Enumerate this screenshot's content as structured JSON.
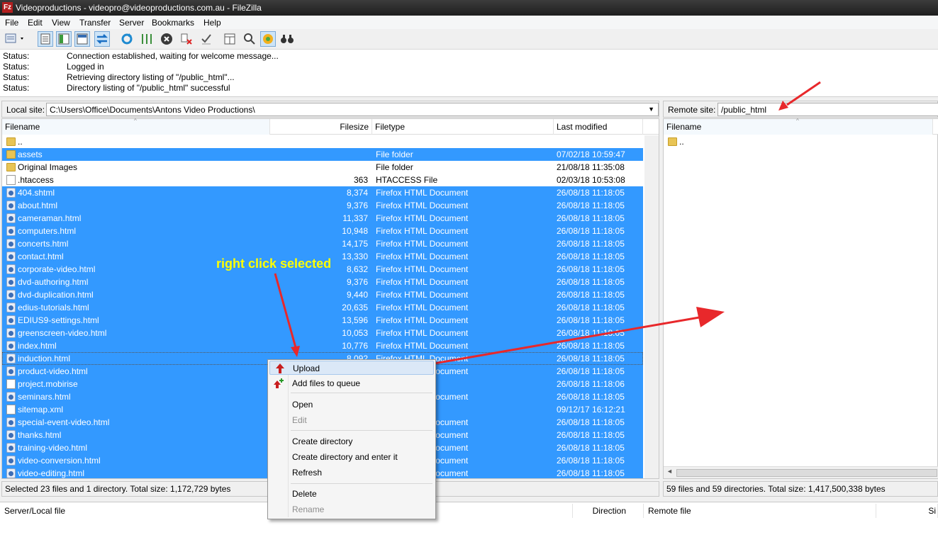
{
  "window": {
    "title": "Videoproductions - videopro@videoproductions.com.au - FileZilla",
    "app_icon": "Fz"
  },
  "menu": [
    "File",
    "Edit",
    "View",
    "Transfer",
    "Server",
    "Bookmarks",
    "Help"
  ],
  "log": [
    {
      "label": "Status:",
      "message": "Connection established, waiting for welcome message..."
    },
    {
      "label": "Status:",
      "message": "Logged in"
    },
    {
      "label": "Status:",
      "message": "Retrieving directory listing of \"/public_html\"..."
    },
    {
      "label": "Status:",
      "message": "Directory listing of \"/public_html\" successful"
    }
  ],
  "local": {
    "site_label": "Local site:",
    "path": "C:\\Users\\Office\\Documents\\Antons Video Productions\\",
    "columns": [
      "Filename",
      "Filesize",
      "Filetype",
      "Last modified"
    ],
    "files": [
      {
        "name": "..",
        "size": "",
        "type": "",
        "modified": "",
        "icon": "folder",
        "sel": false
      },
      {
        "name": "assets",
        "size": "",
        "type": "File folder",
        "modified": "07/02/18 10:59:47",
        "icon": "folder",
        "sel": true
      },
      {
        "name": "Original Images",
        "size": "",
        "type": "File folder",
        "modified": "21/08/18 11:35:08",
        "icon": "folder",
        "sel": false
      },
      {
        "name": ".htaccess",
        "size": "363",
        "type": "HTACCESS File",
        "modified": "02/03/18 10:53:08",
        "icon": "plain",
        "sel": false
      },
      {
        "name": "404.shtml",
        "size": "8,374",
        "type": "Firefox HTML Document",
        "modified": "26/08/18 11:18:05",
        "icon": "html",
        "sel": true
      },
      {
        "name": "about.html",
        "size": "9,376",
        "type": "Firefox HTML Document",
        "modified": "26/08/18 11:18:05",
        "icon": "html",
        "sel": true
      },
      {
        "name": "cameraman.html",
        "size": "11,337",
        "type": "Firefox HTML Document",
        "modified": "26/08/18 11:18:05",
        "icon": "html",
        "sel": true
      },
      {
        "name": "computers.html",
        "size": "10,948",
        "type": "Firefox HTML Document",
        "modified": "26/08/18 11:18:05",
        "icon": "html",
        "sel": true
      },
      {
        "name": "concerts.html",
        "size": "14,175",
        "type": "Firefox HTML Document",
        "modified": "26/08/18 11:18:05",
        "icon": "html",
        "sel": true
      },
      {
        "name": "contact.html",
        "size": "13,330",
        "type": "Firefox HTML Document",
        "modified": "26/08/18 11:18:05",
        "icon": "html",
        "sel": true
      },
      {
        "name": "corporate-video.html",
        "size": "8,632",
        "type": "Firefox HTML Document",
        "modified": "26/08/18 11:18:05",
        "icon": "html",
        "sel": true
      },
      {
        "name": "dvd-authoring.html",
        "size": "9,376",
        "type": "Firefox HTML Document",
        "modified": "26/08/18 11:18:05",
        "icon": "html",
        "sel": true
      },
      {
        "name": "dvd-duplication.html",
        "size": "9,440",
        "type": "Firefox HTML Document",
        "modified": "26/08/18 11:18:05",
        "icon": "html",
        "sel": true
      },
      {
        "name": "edius-tutorials.html",
        "size": "20,635",
        "type": "Firefox HTML Document",
        "modified": "26/08/18 11:18:05",
        "icon": "html",
        "sel": true
      },
      {
        "name": "EDIUS9-settings.html",
        "size": "13,596",
        "type": "Firefox HTML Document",
        "modified": "26/08/18 11:18:05",
        "icon": "html",
        "sel": true
      },
      {
        "name": "greenscreen-video.html",
        "size": "10,053",
        "type": "Firefox HTML Document",
        "modified": "26/08/18 11:18:05",
        "icon": "html",
        "sel": true
      },
      {
        "name": "index.html",
        "size": "10,776",
        "type": "Firefox HTML Document",
        "modified": "26/08/18 11:18:05",
        "icon": "html",
        "sel": true
      },
      {
        "name": "induction.html",
        "size": "8,092",
        "type": "Firefox HTML Document",
        "modified": "26/08/18 11:18:05",
        "icon": "html",
        "sel": true
      },
      {
        "name": "product-video.html",
        "size": "",
        "type": "Firefox HTML Document",
        "modified": "26/08/18 11:18:05",
        "icon": "html",
        "sel": true
      },
      {
        "name": "project.mobirise",
        "size": "",
        "type": "",
        "modified": "26/08/18 11:18:06",
        "icon": "plain",
        "sel": true
      },
      {
        "name": "seminars.html",
        "size": "",
        "type": "Firefox HTML Document",
        "modified": "26/08/18 11:18:05",
        "icon": "html",
        "sel": true
      },
      {
        "name": "sitemap.xml",
        "size": "",
        "type": "",
        "modified": "09/12/17 16:12:21",
        "icon": "plain",
        "sel": true
      },
      {
        "name": "special-event-video.html",
        "size": "",
        "type": "Firefox HTML Document",
        "modified": "26/08/18 11:18:05",
        "icon": "html",
        "sel": true
      },
      {
        "name": "thanks.html",
        "size": "",
        "type": "Firefox HTML Document",
        "modified": "26/08/18 11:18:05",
        "icon": "html",
        "sel": true
      },
      {
        "name": "training-video.html",
        "size": "",
        "type": "Firefox HTML Document",
        "modified": "26/08/18 11:18:05",
        "icon": "html",
        "sel": true
      },
      {
        "name": "video-conversion.html",
        "size": "",
        "type": "Firefox HTML Document",
        "modified": "26/08/18 11:18:05",
        "icon": "html",
        "sel": true
      },
      {
        "name": "video-editing.html",
        "size": "",
        "type": "Firefox HTML Document",
        "modified": "26/08/18 11:18:05",
        "icon": "html",
        "sel": true
      }
    ],
    "status": "Selected 23 files and 1 directory. Total size: 1,172,729 bytes"
  },
  "remote": {
    "site_label": "Remote site:",
    "path": "/public_html",
    "columns": [
      "Filename"
    ],
    "files": [
      {
        "name": "..",
        "icon": "folder"
      }
    ],
    "status": "59 files and 59 directories. Total size: 1,417,500,338 bytes"
  },
  "queue": {
    "columns": [
      "Server/Local file",
      "Direction",
      "Remote file",
      "Si"
    ]
  },
  "context_menu": [
    {
      "label": "Upload",
      "icon": "upload-arrow-icon",
      "disabled": false,
      "highlight": true
    },
    {
      "label": "Add files to queue",
      "icon": "add-to-queue-icon",
      "disabled": false
    },
    {
      "sep": true
    },
    {
      "label": "Open",
      "disabled": false
    },
    {
      "label": "Edit",
      "disabled": true
    },
    {
      "sep": true
    },
    {
      "label": "Create directory",
      "disabled": false
    },
    {
      "label": "Create directory and enter it",
      "disabled": false
    },
    {
      "label": "Refresh",
      "disabled": false
    },
    {
      "sep": true
    },
    {
      "label": "Delete",
      "disabled": false
    },
    {
      "label": "Rename",
      "disabled": true
    }
  ],
  "annotation": {
    "text": "right click selected",
    "color": "#ffff00",
    "arrow_color": "#e8282b"
  },
  "colors": {
    "selection": "#3399ff",
    "title_bg": "#2b2b2b"
  }
}
